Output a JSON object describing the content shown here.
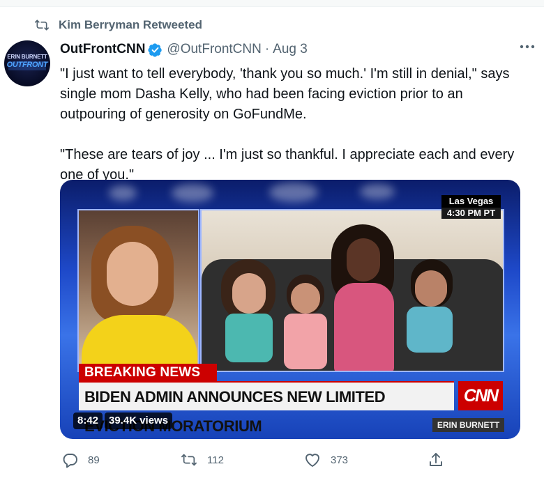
{
  "retweet_header": {
    "text": "Kim Berryman Retweeted"
  },
  "avatar": {
    "line1": "ERIN BURNETT",
    "line2": "OUTFRONT"
  },
  "author": {
    "name": "OutFrontCNN",
    "handle": "@OutFrontCNN",
    "separator": "·",
    "date": "Aug 3"
  },
  "tweet": {
    "text": "\"I just want to tell everybody, 'thank you so much.' I'm still in denial,\" says single mom Dasha Kelly, who had been facing eviction prior to an outpouring of generosity on GoFundMe.\n\n\"These are tears of joy ... I'm just so thankful. I appreciate each and every one of you.\""
  },
  "video": {
    "location": "Las Vegas",
    "time": "4:30 PM PT",
    "breaking": "BREAKING NEWS",
    "headline": "BIDEN ADMIN ANNOUNCES NEW LIMITED EVICTION MORATORIUM",
    "network": "CNN",
    "anchor": "ERIN BURNETT",
    "duration": "8:42",
    "views": "39.4K views"
  },
  "actions": {
    "replies": "89",
    "retweets": "112",
    "likes": "373"
  },
  "colors": {
    "accent": "#1d9bf0",
    "muted": "#536471",
    "cnn_red": "#cc0000"
  }
}
